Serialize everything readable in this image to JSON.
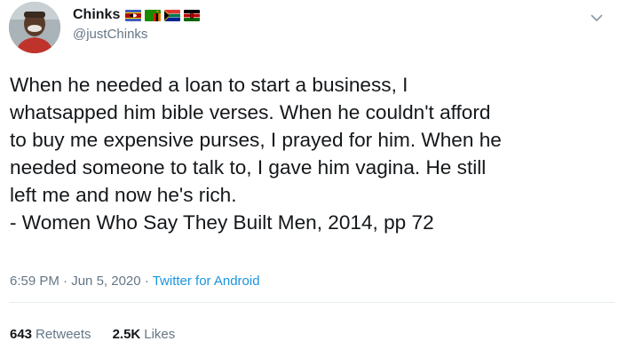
{
  "user": {
    "display_name": "Chinks",
    "handle": "@justChinks",
    "flags": [
      "eswatini-flag-icon",
      "zambia-flag-icon",
      "south-africa-flag-icon",
      "kenya-flag-icon"
    ]
  },
  "tweet": {
    "lines": [
      "When he needed a loan to start a business, I",
      "whatsapped him bible verses. When he couldn't afford",
      "to buy me expensive purses, I prayed for him. When he",
      "needed someone to talk to, I gave him vagina. He still",
      "left me and now he's rich.",
      "- Women Who Say They Built Men, 2014, pp 72"
    ]
  },
  "meta": {
    "time": "6:59 PM",
    "separator_1": " · ",
    "date": "Jun 5, 2020",
    "separator_2": " · ",
    "source": "Twitter for Android"
  },
  "stats": {
    "retweets_count": "643",
    "retweets_label": "Retweets",
    "likes_count": "2.5K",
    "likes_label": "Likes"
  },
  "colors": {
    "text": "#14171a",
    "secondary": "#657786",
    "link": "#1b95e0",
    "divider": "#e6ecf0"
  }
}
